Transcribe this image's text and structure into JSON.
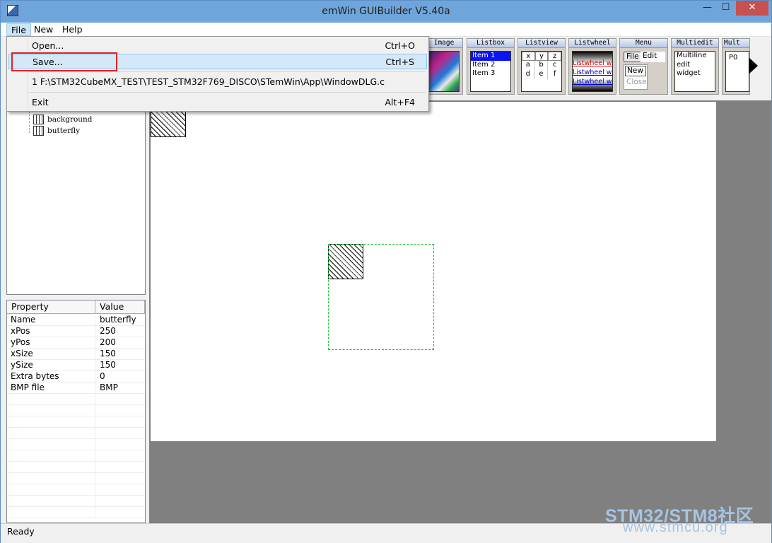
{
  "window": {
    "title": "emWin GUIBuilder V5.40a",
    "controls": {
      "minimize": "—",
      "maximize": "☐",
      "close": "✕"
    }
  },
  "menubar": {
    "file": "File",
    "new": "New",
    "help": "Help"
  },
  "file_menu": {
    "open_label": "Open...",
    "open_shortcut": "Ctrl+O",
    "save_label": "Save...",
    "save_shortcut": "Ctrl+S",
    "recent_label": "1 F:\\STM32CubeMX_TEST\\TEST_STM32F769_DISCO\\STemWin\\App\\WindowDLG.c",
    "exit_label": "Exit",
    "exit_shortcut": "Alt+F4"
  },
  "tree": {
    "nodes": [
      "background",
      "butterfly"
    ]
  },
  "properties": {
    "headers": {
      "property": "Property",
      "value": "Value"
    },
    "rows": [
      {
        "name": "Name",
        "value": "butterfly"
      },
      {
        "name": "xPos",
        "value": "250"
      },
      {
        "name": "yPos",
        "value": "200"
      },
      {
        "name": "xSize",
        "value": "150"
      },
      {
        "name": "ySize",
        "value": "150"
      },
      {
        "name": "Extra bytes",
        "value": "0"
      },
      {
        "name": "BMP file",
        "value": "BMP"
      }
    ]
  },
  "palette": {
    "image": "Image",
    "listbox": {
      "title": "Listbox",
      "items": [
        "Item 1",
        "Item 2",
        "Item 3"
      ]
    },
    "listview": {
      "title": "Listview",
      "cells": [
        "x",
        "y",
        "z",
        "a",
        "b",
        "c",
        "d",
        "e",
        "f"
      ]
    },
    "listwheel": {
      "title": "Listwheel",
      "items": [
        "Listwheel wi",
        "Listwheel wi",
        "Listwheel wi"
      ]
    },
    "menu": {
      "title": "Menu",
      "file": "File",
      "edit": "Edit",
      "new": "New",
      "close": "Close"
    },
    "multiedit": {
      "title": "Multiedit",
      "lines": [
        "Multiline",
        "edit",
        "widget"
      ]
    },
    "mult": {
      "title": "Mult",
      "p0": "P0"
    }
  },
  "status": {
    "text": "Ready"
  },
  "watermark": {
    "line1": "STM32/STM8社区",
    "line2": "www.stmcu.org"
  },
  "colors": {
    "title_bar": "#6fa5da",
    "close_button": "#c75050",
    "selection": "#1fbf3a",
    "highlight_box": "#e02424"
  }
}
